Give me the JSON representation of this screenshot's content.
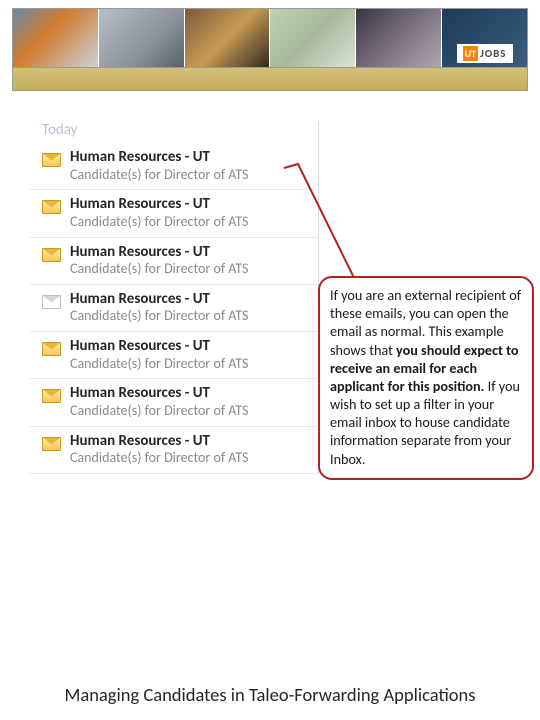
{
  "banner": {
    "logo_ut": "UT",
    "logo_jobs": "JOBS"
  },
  "inbox": {
    "day_label": "Today",
    "items": [
      {
        "from": "Human Resources - UT",
        "subject": "Candidate(s) for Director of ATS",
        "read": false
      },
      {
        "from": "Human Resources - UT",
        "subject": "Candidate(s) for Director of ATS",
        "read": false
      },
      {
        "from": "Human Resources - UT",
        "subject": "Candidate(s) for Director of ATS",
        "read": false
      },
      {
        "from": "Human Resources - UT",
        "subject": "Candidate(s) for Director of ATS",
        "read": true
      },
      {
        "from": "Human Resources - UT",
        "subject": "Candidate(s) for Director of ATS",
        "read": false
      },
      {
        "from": "Human Resources - UT",
        "subject": "Candidate(s) for Director of ATS",
        "read": false
      },
      {
        "from": "Human Resources - UT",
        "subject": "Candidate(s) for Director of ATS",
        "read": false
      }
    ]
  },
  "callout": {
    "part1": "If you are an external recipient of these emails, you can open the email as normal. This example shows that ",
    "bold": "you should expect to receive an email for each applicant for this position.",
    "part2": "  If you wish to set up a filter in your email inbox to house candidate information separate from your Inbox."
  },
  "footer": "Managing Candidates in Taleo-Forwarding Applications"
}
